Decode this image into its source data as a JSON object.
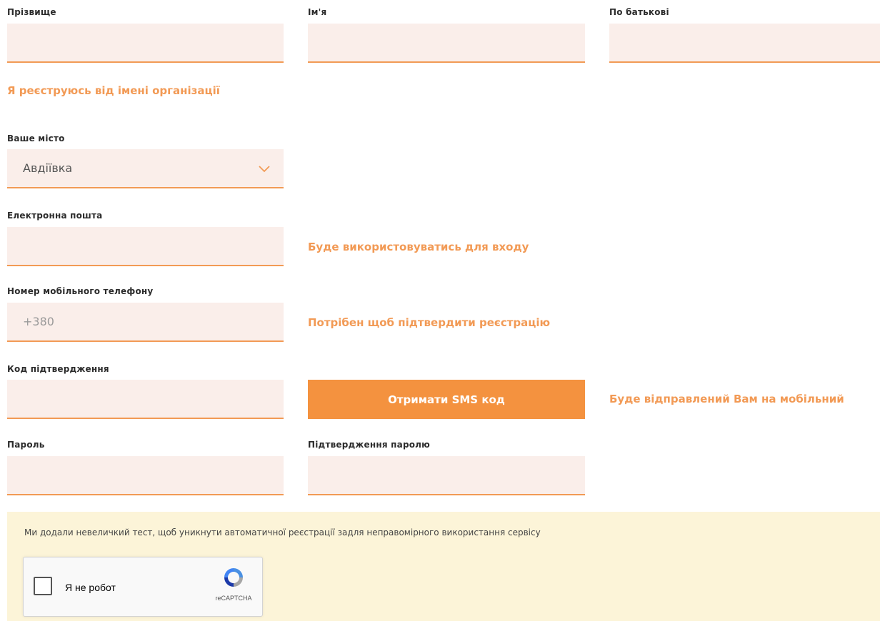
{
  "form": {
    "surname_label": "Прізвище",
    "name_label": "Ім'я",
    "patronymic_label": "По батькові",
    "org_link": "Я реєструюсь від імені організації",
    "city_label": "Ваше місто",
    "city_value": "Авдіївка",
    "email_label": "Електронна пошта",
    "email_hint": "Буде використовуватись для входу",
    "phone_label": "Номер мобільного телефону",
    "phone_placeholder": "+380",
    "phone_hint": "Потрібен щоб підтвердити реєстрацію",
    "code_label": "Код підтвердження",
    "sms_button": "Отримати SMS код",
    "code_hint": "Буде відправлений Вам на мобільний",
    "password_label": "Пароль",
    "password_confirm_label": "Підтвердження паролю"
  },
  "captcha": {
    "note": "Ми додали невеличкий тест, щоб уникнути автоматичної реєстрації задля неправомірного використання сервісу",
    "checkbox_label": "Я не робот",
    "brand": "reCAPTCHA"
  },
  "colors": {
    "accent": "#f4923f",
    "field_bg": "#faeeea",
    "captcha_bg": "#fcf4d8"
  }
}
